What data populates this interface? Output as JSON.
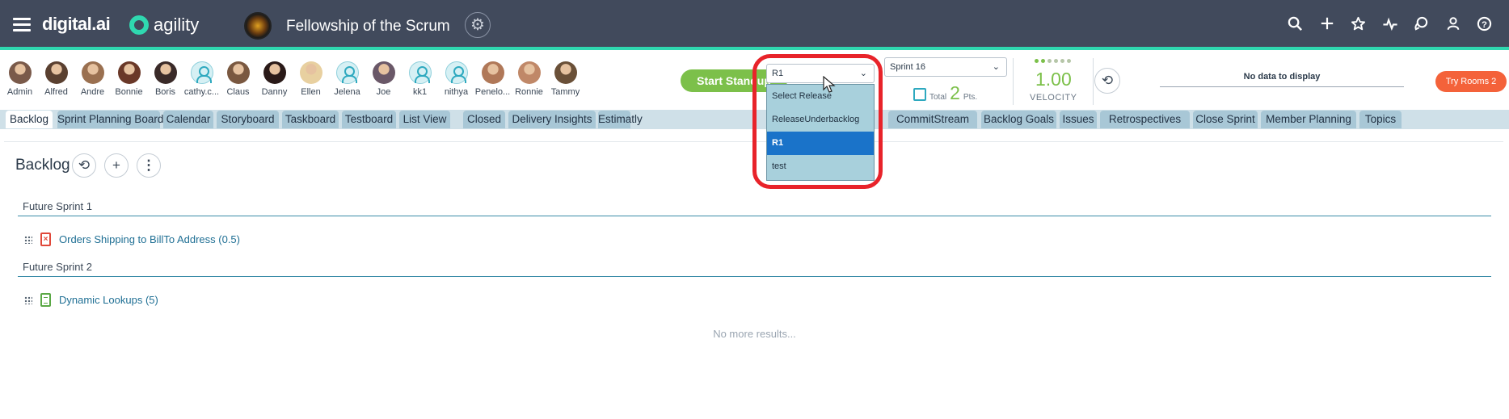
{
  "header": {
    "brand": "digital.ai",
    "product": "agility",
    "team_name": "Fellowship of the Scrum",
    "icons": [
      "search-icon",
      "plus-icon",
      "star-icon",
      "pulse-icon",
      "chat-icon",
      "user-icon",
      "help-icon"
    ]
  },
  "members": [
    {
      "name": "Admin",
      "color": "#7a5a4a"
    },
    {
      "name": "Alfred",
      "color": "#5a4030"
    },
    {
      "name": "Andre",
      "color": "#9a7050"
    },
    {
      "name": "Bonnie",
      "color": "#6a3828"
    },
    {
      "name": "Boris",
      "color": "#3a2a28"
    },
    {
      "name": "cathy.c...",
      "color": "generic"
    },
    {
      "name": "Claus",
      "color": "#7a5840"
    },
    {
      "name": "Danny",
      "color": "#2a1a18"
    },
    {
      "name": "Ellen",
      "color": "#e8d0a0"
    },
    {
      "name": "Jelena",
      "color": "generic"
    },
    {
      "name": "Joe",
      "color": "#6a5868"
    },
    {
      "name": "kk1",
      "color": "generic"
    },
    {
      "name": "nithya",
      "color": "generic"
    },
    {
      "name": "Penelo...",
      "color": "#b07858"
    },
    {
      "name": "Ronnie",
      "color": "#c08868"
    },
    {
      "name": "Tammy",
      "color": "#6a5038"
    }
  ],
  "standup": {
    "label": "Start Standup"
  },
  "release_select": {
    "value": "R1",
    "options": [
      "Select Release",
      "ReleaseUnderbacklog",
      "R1",
      "test"
    ],
    "selected_index": 2
  },
  "sprint_select": {
    "value": "Sprint 16"
  },
  "points": {
    "total_label": "Total",
    "value": "2",
    "unit": "Pts."
  },
  "velocity": {
    "value": "1.00",
    "label": "VELOCITY"
  },
  "burndown": {
    "no_data": "No data to display"
  },
  "try_rooms": {
    "label": "Try Rooms 2"
  },
  "tabs": [
    {
      "label": "Backlog",
      "active": true
    },
    {
      "label": "Sprint Planning Board"
    },
    {
      "label": "Calendar"
    },
    {
      "label": "Storyboard"
    },
    {
      "label": "Taskboard"
    },
    {
      "label": "Testboard"
    },
    {
      "label": "List View"
    },
    {
      "label": "Closed"
    },
    {
      "label": "Delivery Insights"
    },
    {
      "label": "Estimatly"
    },
    {
      "label": "CommitStream"
    },
    {
      "label": "Backlog Goals"
    },
    {
      "label": "Issues"
    },
    {
      "label": "Retrospectives"
    },
    {
      "label": "Close Sprint"
    },
    {
      "label": "Member Planning"
    },
    {
      "label": "Topics"
    }
  ],
  "backlog": {
    "title": "Backlog",
    "groups": [
      {
        "label": "Future Sprint 1",
        "items": [
          {
            "title": "Orders Shipping to BillTo Address (0.5)",
            "type": "defect"
          }
        ]
      },
      {
        "label": "Future Sprint 2",
        "items": [
          {
            "title": "Dynamic Lookups (5)",
            "type": "story"
          }
        ]
      }
    ],
    "no_more": "No more results..."
  },
  "colors": {
    "header_bg": "#414a5c",
    "accent": "#2fd8b0",
    "green": "#7cc04a",
    "highlight": "#e8232a"
  }
}
